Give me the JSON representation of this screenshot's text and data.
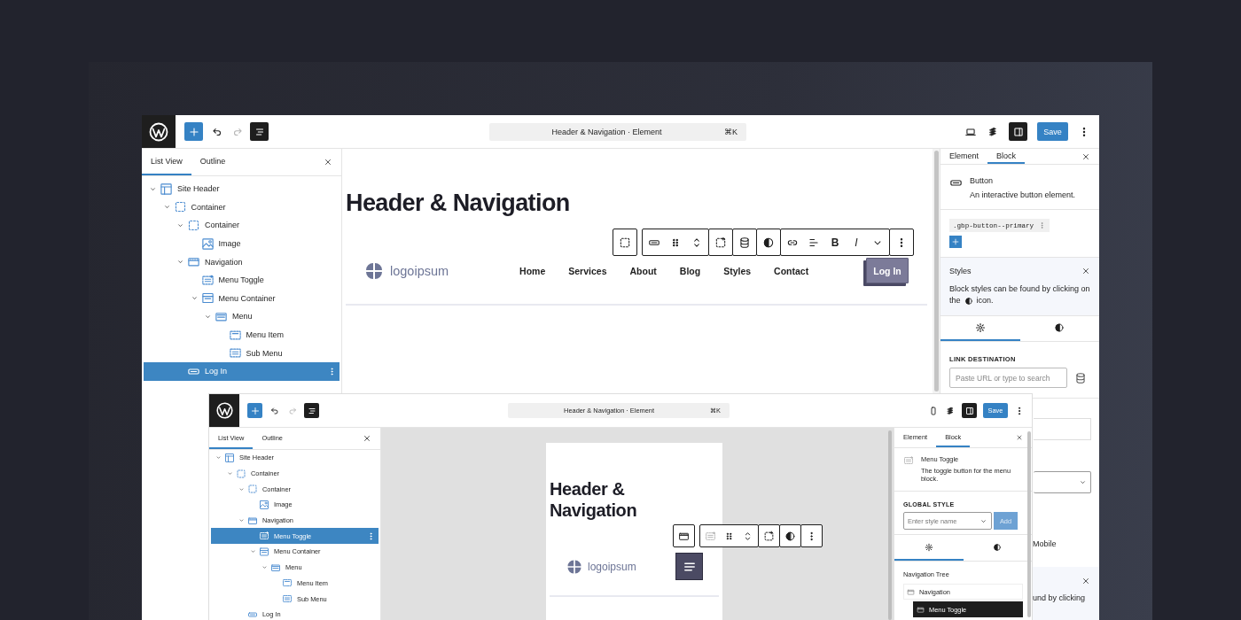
{
  "back_window": {
    "toolbar": {
      "title": "Header & Navigation · Element",
      "shortcut": "⌘K",
      "save": "Save"
    },
    "list_view": {
      "tabs": [
        {
          "label": "List View",
          "selected": true
        },
        {
          "label": "Outline",
          "selected": false
        }
      ],
      "tree": [
        {
          "label": "Site Header",
          "kind": "header",
          "expanded": true,
          "selected": false,
          "children": [
            {
              "label": "Container",
              "kind": "container",
              "expanded": true,
              "selected": false,
              "children": [
                {
                  "label": "Container",
                  "kind": "container",
                  "expanded": true,
                  "selected": false,
                  "children": [
                    {
                      "label": "Image",
                      "kind": "image",
                      "selected": false
                    }
                  ]
                },
                {
                  "label": "Navigation",
                  "kind": "navigation",
                  "expanded": true,
                  "selected": false,
                  "children": [
                    {
                      "label": "Menu Toggle",
                      "kind": "toggle",
                      "selected": false
                    },
                    {
                      "label": "Menu Container",
                      "kind": "menu-container",
                      "expanded": true,
                      "selected": false,
                      "children": [
                        {
                          "label": "Menu",
                          "kind": "menu",
                          "expanded": true,
                          "selected": false,
                          "children": [
                            {
                              "label": "Menu Item",
                              "kind": "menu-item",
                              "selected": false
                            },
                            {
                              "label": "Sub Menu",
                              "kind": "sub-menu",
                              "selected": false
                            }
                          ]
                        }
                      ]
                    }
                  ]
                },
                {
                  "label": "Log In",
                  "kind": "button",
                  "selected": true
                }
              ]
            }
          ]
        }
      ]
    },
    "canvas": {
      "heading": "Header & Navigation",
      "logo": "logoipsum",
      "nav": [
        "Home",
        "Services",
        "About",
        "Blog",
        "Styles",
        "Contact"
      ],
      "button": "Log In",
      "format_buttons": [
        "B",
        "I"
      ]
    },
    "sidebar": {
      "tabs": [
        {
          "label": "Element",
          "selected": false
        },
        {
          "label": "Block",
          "selected": true
        }
      ],
      "block_name": "Button",
      "block_description": "An interactive button element.",
      "class_name": ".gbp-button--primary",
      "notice": {
        "title": "Styles",
        "text_lines": [
          "Block styles can be found by clicking on",
          "the"
        ],
        "text_end": "icon."
      },
      "panel_tabs": [
        {
          "kind": "settings",
          "selected": true
        },
        {
          "kind": "styles",
          "selected": false
        }
      ],
      "link_label": "LINK DESTINATION",
      "link_placeholder": "Paste URL or type to search",
      "toggle_label": "Mobile",
      "notice_text": "und by clicking"
    }
  },
  "front_window": {
    "toolbar": {
      "title": "Header & Navigation · Element",
      "shortcut": "⌘K",
      "save": "Save"
    },
    "list_view": {
      "tabs": [
        {
          "label": "List View",
          "selected": true
        },
        {
          "label": "Outline",
          "selected": false
        }
      ],
      "tree": [
        {
          "label": "Site Header",
          "kind": "header",
          "expanded": true,
          "selected": false,
          "children": [
            {
              "label": "Container",
              "kind": "container",
              "expanded": true,
              "selected": false,
              "children": [
                {
                  "label": "Container",
                  "kind": "container",
                  "expanded": true,
                  "selected": false,
                  "children": [
                    {
                      "label": "Image",
                      "kind": "image",
                      "selected": false
                    }
                  ]
                },
                {
                  "label": "Navigation",
                  "kind": "navigation",
                  "expanded": true,
                  "selected": false,
                  "children": [
                    {
                      "label": "Menu Toggle",
                      "kind": "toggle",
                      "selected": true
                    },
                    {
                      "label": "Menu Container",
                      "kind": "menu-container",
                      "expanded": true,
                      "selected": false,
                      "children": [
                        {
                          "label": "Menu",
                          "kind": "menu",
                          "expanded": true,
                          "selected": false,
                          "children": [
                            {
                              "label": "Menu Item",
                              "kind": "menu-item",
                              "selected": false
                            },
                            {
                              "label": "Sub Menu",
                              "kind": "sub-menu",
                              "selected": false
                            }
                          ]
                        }
                      ]
                    }
                  ]
                },
                {
                  "label": "Log In",
                  "kind": "button",
                  "selected": false
                }
              ]
            }
          ]
        }
      ]
    },
    "canvas": {
      "heading": "Header & Navigation",
      "logo": "logoipsum"
    },
    "sidebar": {
      "tabs": [
        {
          "label": "Element",
          "selected": false
        },
        {
          "label": "Block",
          "selected": true
        }
      ],
      "block_name": "Menu Toggle",
      "block_description": "The toggle button for the menu block.",
      "style_label": "GLOBAL STYLE",
      "style_placeholder": "Enter style name",
      "add": "Add",
      "add_disabled": true,
      "panel_tabs": [
        {
          "kind": "settings",
          "selected": true
        },
        {
          "kind": "styles",
          "selected": false
        }
      ],
      "tree_label": "Navigation Tree",
      "nav_tree": [
        {
          "label": "Navigation",
          "selected": false,
          "children": [
            {
              "label": "Menu Toggle",
              "selected": true
            }
          ]
        }
      ]
    }
  }
}
